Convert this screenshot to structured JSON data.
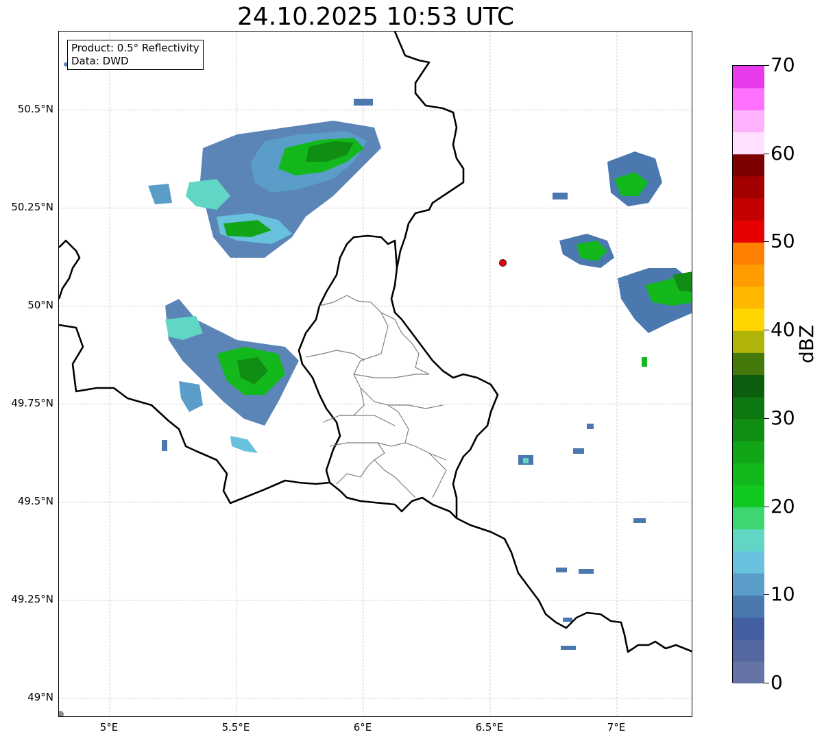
{
  "title": "24.10.2025 10:53 UTC",
  "info": {
    "line1": "Product: 0.5° Reflectivity",
    "line2": "Data: DWD"
  },
  "map": {
    "lat_range": [
      48.95,
      50.7
    ],
    "lon_range": [
      4.8,
      7.3
    ],
    "lat_ticks": [
      {
        "value": 49.0,
        "label": "49°N"
      },
      {
        "value": 49.25,
        "label": "49.25°N"
      },
      {
        "value": 49.5,
        "label": "49.5°N"
      },
      {
        "value": 49.75,
        "label": "49.75°N"
      },
      {
        "value": 50.0,
        "label": "50°N"
      },
      {
        "value": 50.25,
        "label": "50.25°N"
      },
      {
        "value": 50.5,
        "label": "50.5°N"
      }
    ],
    "lon_ticks": [
      {
        "value": 5.0,
        "label": "5°E"
      },
      {
        "value": 5.5,
        "label": "5.5°E"
      },
      {
        "value": 6.0,
        "label": "6°E"
      },
      {
        "value": 6.5,
        "label": "6.5°E"
      },
      {
        "value": 7.0,
        "label": "7°E"
      }
    ],
    "radar_site": {
      "lon": 6.55,
      "lat": 50.11,
      "color": "#e8000b"
    },
    "gridlines": true
  },
  "colorbar": {
    "unit": "dBZ",
    "min": 0,
    "max": 70,
    "ticks": [
      {
        "value": 0,
        "label": "0"
      },
      {
        "value": 10,
        "label": "10"
      },
      {
        "value": 20,
        "label": "20"
      },
      {
        "value": 30,
        "label": "30"
      },
      {
        "value": 40,
        "label": "40"
      },
      {
        "value": 50,
        "label": "50"
      },
      {
        "value": 60,
        "label": "60"
      },
      {
        "value": 70,
        "label": "70"
      }
    ],
    "colors": [
      "#6673a7",
      "#5467a0",
      "#435ea1",
      "#4a78af",
      "#5a9dc8",
      "#68c1dd",
      "#62d6c5",
      "#3dd671",
      "#12c91f",
      "#12b81c",
      "#12a518",
      "#108e14",
      "#0d7712",
      "#0a5e0e",
      "#447a0b",
      "#b0b409",
      "#ffd600",
      "#ffb800",
      "#ff9d00",
      "#ff8000",
      "#e60000",
      "#c40000",
      "#a30000",
      "#7d0000",
      "#ffe0ff",
      "#ffb3ff",
      "#ff70ff",
      "#e83aeb"
    ]
  }
}
